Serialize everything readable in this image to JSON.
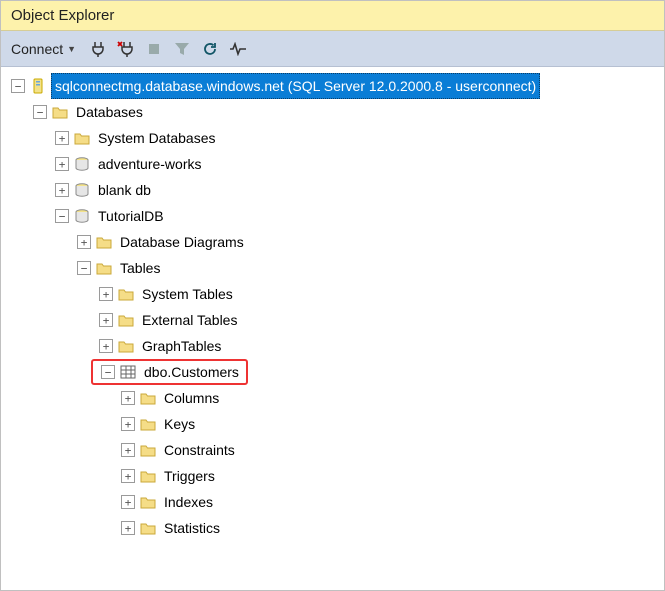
{
  "title": "Object Explorer",
  "toolbar": {
    "connect_label": "Connect"
  },
  "tree": {
    "server": "sqlconnectmg.database.windows.net (SQL Server 12.0.2000.8 - userconnect)",
    "databases": "Databases",
    "system_databases": "System Databases",
    "adventure_works": "adventure-works",
    "blank_db": "blank db",
    "tutorialdb": "TutorialDB",
    "db_diagrams": "Database Diagrams",
    "tables": "Tables",
    "system_tables": "System Tables",
    "external_tables": "External Tables",
    "graph_tables": "GraphTables",
    "dbo_customers": "dbo.Customers",
    "columns": "Columns",
    "keys": "Keys",
    "constraints": "Constraints",
    "triggers": "Triggers",
    "indexes": "Indexes",
    "statistics": "Statistics"
  }
}
